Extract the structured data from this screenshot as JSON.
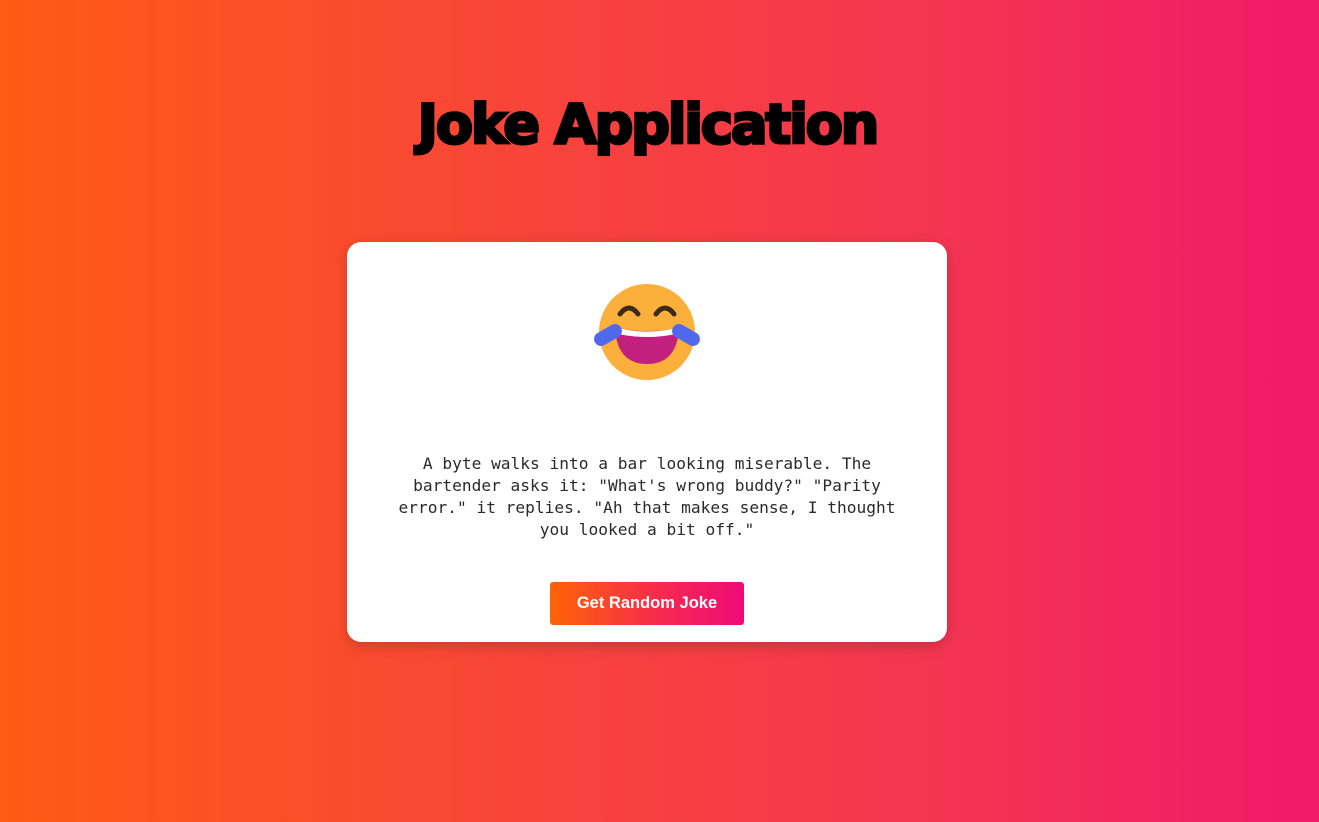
{
  "header": {
    "title": "Joke Application"
  },
  "card": {
    "emoji_icon": "face-with-tears-of-joy-icon",
    "joke": "A byte walks into a bar looking miserable. The bartender asks it: \"What's wrong buddy?\" \"Parity error.\" it replies. \"Ah that makes sense, I thought you looked a bit off.\"",
    "button_label": "Get Random Joke"
  },
  "colors": {
    "gradient_start": "#ff5b14",
    "gradient_end": "#f0196a",
    "card_background": "#ffffff",
    "emoji_face": "#fbb03b",
    "emoji_mouth": "#c2207e",
    "emoji_tears": "#4f68ec"
  }
}
